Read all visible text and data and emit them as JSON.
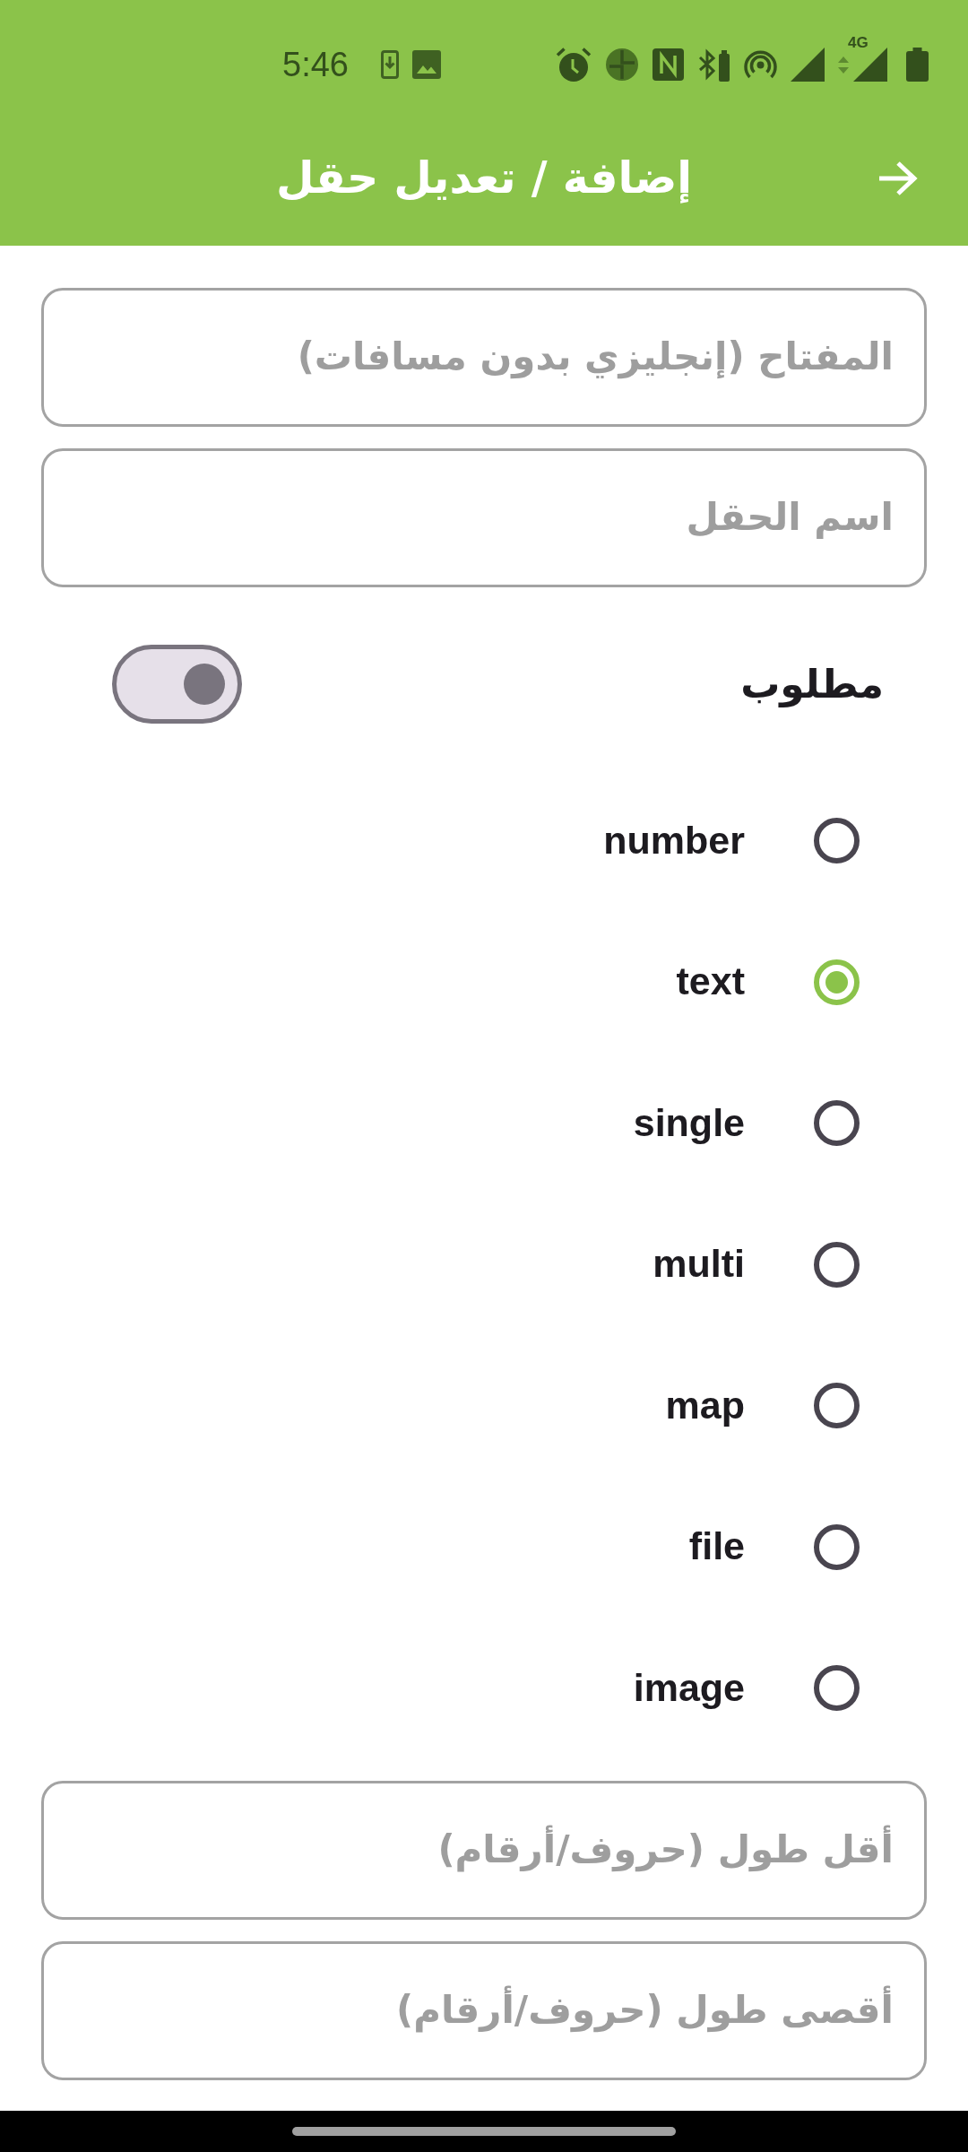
{
  "status_bar": {
    "time": "5:46",
    "network_type": "4G"
  },
  "app_bar": {
    "title": "إضافة / تعديل حقل"
  },
  "top_fields": [
    {
      "placeholder": "المفتاح (إنجليزي بدون مسافات)"
    },
    {
      "placeholder": "اسم الحقل"
    }
  ],
  "required_switch": {
    "label": "مطلوب",
    "on": false
  },
  "field_types": [
    {
      "label": "number",
      "selected": false
    },
    {
      "label": "text",
      "selected": true
    },
    {
      "label": "single",
      "selected": false
    },
    {
      "label": "multi",
      "selected": false
    },
    {
      "label": "map",
      "selected": false
    },
    {
      "label": "file",
      "selected": false
    },
    {
      "label": "image",
      "selected": false
    }
  ],
  "bottom_fields": [
    {
      "placeholder": "أقل طول (حروف/أرقام)"
    },
    {
      "placeholder": "أقصى طول (حروف/أرقام)"
    }
  ]
}
